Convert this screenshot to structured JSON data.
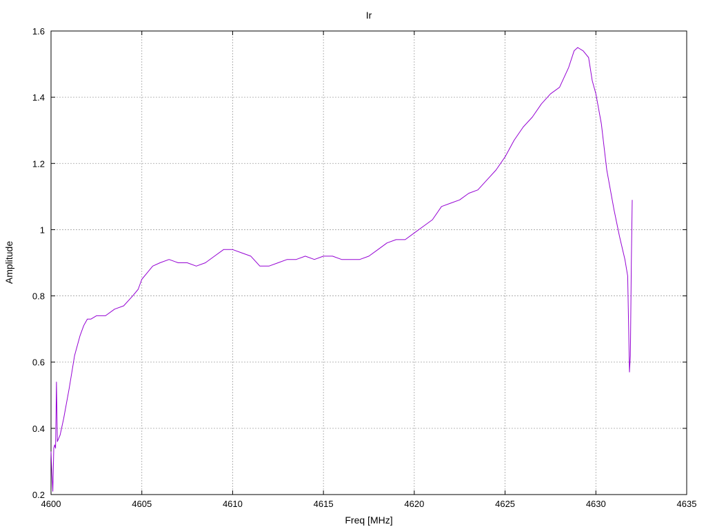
{
  "chart_data": {
    "type": "line",
    "title": "Ir",
    "xlabel": "Freq [MHz]",
    "ylabel": "Amplitude",
    "xlim": [
      4600,
      4635
    ],
    "ylim": [
      0.2,
      1.6
    ],
    "x_ticks": [
      4600,
      4605,
      4610,
      4615,
      4620,
      4625,
      4630,
      4635
    ],
    "y_ticks": [
      0.2,
      0.4,
      0.6,
      0.8,
      1,
      1.2,
      1.4,
      1.6
    ],
    "x_tick_labels": [
      "4600",
      "4605",
      "4610",
      "4615",
      "4620",
      "4625",
      "4630",
      "4635"
    ],
    "y_tick_labels": [
      "0.2",
      "0.4",
      "0.6",
      "0.8",
      "1",
      "1.2",
      "1.4",
      "1.6"
    ],
    "grid": true,
    "line_color": "#9400d3",
    "series": [
      {
        "x": [
          4600.0,
          4600.05,
          4600.1,
          4600.15,
          4600.2,
          4600.25,
          4600.3,
          4600.35,
          4600.5,
          4600.7,
          4601.0,
          4601.3,
          4601.6,
          4601.8,
          4602.0,
          4602.2,
          4602.5,
          4603.0,
          4603.5,
          4604.0,
          4604.5,
          4604.8,
          4605.0,
          4605.3,
          4605.6,
          4606.0,
          4606.5,
          4607.0,
          4607.5,
          4608.0,
          4608.5,
          4609.0,
          4609.5,
          4610.0,
          4610.5,
          4611.0,
          4611.5,
          4612.0,
          4612.5,
          4613.0,
          4613.5,
          4614.0,
          4614.5,
          4615.0,
          4615.5,
          4616.0,
          4616.5,
          4617.0,
          4617.5,
          4618.0,
          4618.5,
          4619.0,
          4619.5,
          4620.0,
          4620.5,
          4621.0,
          4621.5,
          4622.0,
          4622.5,
          4623.0,
          4623.5,
          4624.0,
          4624.5,
          4625.0,
          4625.5,
          4626.0,
          4626.5,
          4627.0,
          4627.5,
          4628.0,
          4628.5,
          4628.8,
          4629.0,
          4629.3,
          4629.6,
          4629.8,
          4630.0,
          4630.3,
          4630.6,
          4631.0,
          4631.3,
          4631.6,
          4631.75,
          4631.85,
          4631.9,
          4631.95,
          4632.0
        ],
        "y": [
          0.33,
          0.26,
          0.21,
          0.34,
          0.35,
          0.34,
          0.54,
          0.36,
          0.38,
          0.43,
          0.52,
          0.62,
          0.68,
          0.71,
          0.73,
          0.73,
          0.74,
          0.74,
          0.76,
          0.77,
          0.8,
          0.82,
          0.85,
          0.87,
          0.89,
          0.9,
          0.91,
          0.9,
          0.9,
          0.89,
          0.9,
          0.92,
          0.94,
          0.94,
          0.93,
          0.92,
          0.89,
          0.89,
          0.9,
          0.91,
          0.91,
          0.92,
          0.91,
          0.92,
          0.92,
          0.91,
          0.91,
          0.91,
          0.92,
          0.94,
          0.96,
          0.97,
          0.97,
          0.99,
          1.01,
          1.03,
          1.07,
          1.08,
          1.09,
          1.11,
          1.12,
          1.15,
          1.18,
          1.22,
          1.27,
          1.31,
          1.34,
          1.38,
          1.41,
          1.43,
          1.49,
          1.54,
          1.55,
          1.54,
          1.52,
          1.45,
          1.41,
          1.32,
          1.18,
          1.06,
          0.98,
          0.91,
          0.86,
          0.57,
          0.62,
          0.9,
          1.09
        ]
      }
    ]
  }
}
